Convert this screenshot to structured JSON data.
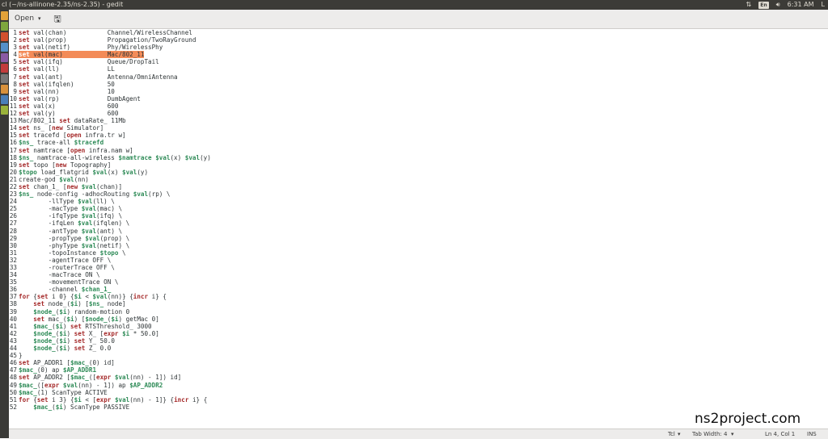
{
  "window": {
    "title": "cl (~/ns-allinone-2.35/ns-2.35) - gedit"
  },
  "tray": {
    "keyboard": "En",
    "volume_icon": "speaker-icon",
    "network_icon": "updown-arrows-icon",
    "time": "6:31 AM",
    "user_initial": "L"
  },
  "launcher": {
    "colors": [
      "#e2a23a",
      "#7ea63d",
      "#d1512e",
      "#5590c7",
      "#8a5aa3",
      "#c23c3c",
      "#777777",
      "#d8913c",
      "#4a7fb8",
      "#9ab33b"
    ]
  },
  "toolbar": {
    "open_label": "Open",
    "open_chevron": "▾",
    "save_icon": "save-icon"
  },
  "editor": {
    "current_line": 4,
    "lines": [
      "set val(chan)           Channel/WirelessChannel",
      "set val(prop)           Propagation/TwoRayGround",
      "set val(netif)          Phy/WirelessPhy",
      "set val(mac)            Mac/802_11",
      "set val(ifq)            Queue/DropTail",
      "set val(ll)             LL",
      "set val(ant)            Antenna/OmniAntenna",
      "set val(ifqlen)         50",
      "set val(nn)             10",
      "set val(rp)             DumbAgent",
      "set val(x)              600",
      "set val(y)              600",
      "Mac/802_11 set dataRate_ 11Mb",
      "set ns_ [new Simulator]",
      "set tracefd [open infra.tr w]",
      "$ns_ trace-all $tracefd",
      "set namtrace [open infra.nam w]",
      "$ns_ namtrace-all-wireless $namtrace $val(x) $val(y)",
      "set topo [new Topography]",
      "$topo load_flatgrid $val(x) $val(y)",
      "create-god $val(nn)",
      "set chan_1_ [new $val(chan)]",
      "$ns_ node-config -adhocRouting $val(rp) \\",
      "        -llType $val(ll) \\",
      "        -macType $val(mac) \\",
      "        -ifqType $val(ifq) \\",
      "        -ifqLen $val(ifqlen) \\",
      "        -antType $val(ant) \\",
      "        -propType $val(prop) \\",
      "        -phyType $val(netif) \\",
      "        -topoInstance $topo \\",
      "        -agentTrace OFF \\",
      "        -routerTrace OFF \\",
      "        -macTrace ON \\",
      "        -movementTrace ON \\",
      "        -channel $chan_1_",
      "for {set i 0} {$i < $val(nn)} {incr i} {",
      "    set node_($i) [$ns_ node]",
      "    $node_($i) random-motion 0",
      "    set mac_($i) [$node_($i) getMac 0]",
      "    $mac_($i) set RTSThreshold_ 3000",
      "    $node_($i) set X_ [expr $i * 50.0]",
      "    $node_($i) set Y_ 50.0",
      "    $node_($i) set Z_ 0.0",
      "}",
      "set AP_ADDR1 [$mac_(0) id]",
      "$mac_(0) ap $AP_ADDR1",
      "set AP_ADDR2 [$mac_([expr $val(nn) - 1]) id]",
      "$mac_([expr $val(nn) - 1]) ap $AP_ADDR2",
      "$mac_(1) ScanType ACTIVE",
      "for {set i 3} {$i < [expr $val(nn) - 1]} {incr i} {",
      "    $mac_($i) ScanType PASSIVE"
    ]
  },
  "status": {
    "language": "Tcl",
    "tab_width": "Tab Width: 4",
    "position": "Ln 4, Col 1",
    "mode": "INS"
  },
  "watermark": "ns2project.com"
}
